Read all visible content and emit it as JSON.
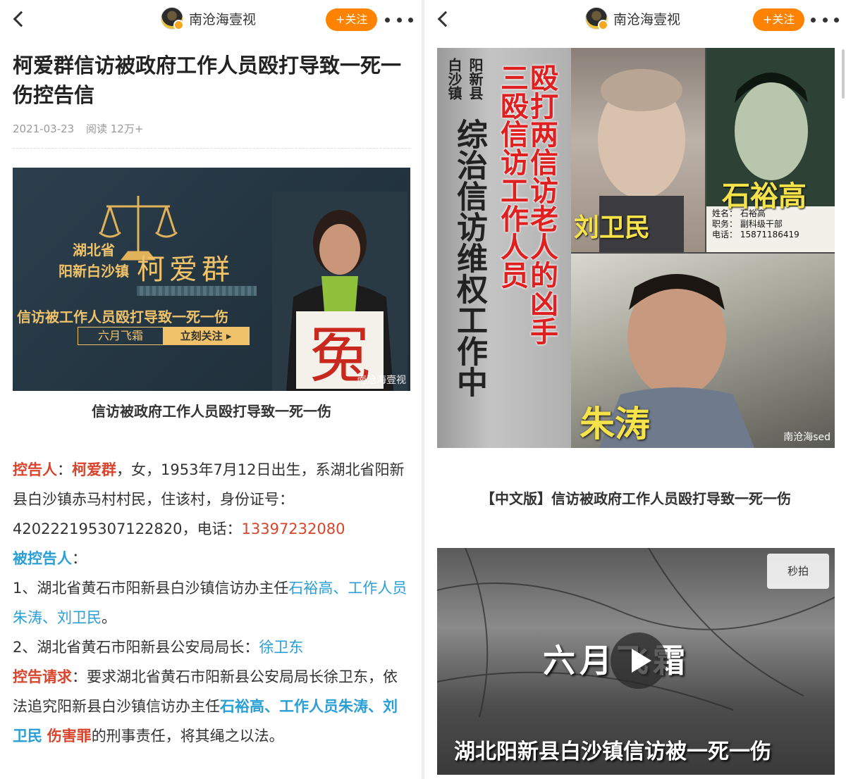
{
  "left": {
    "account_name": "南沧海壹视",
    "follow_label": "+关注",
    "title": "柯爱群信访被政府工作人员殴打导致一死一伤控告信",
    "date": "2021-03-23",
    "read_count": "阅读 12万+",
    "banner": {
      "region_1": "湖北省",
      "region_2": "阳新白沙镇",
      "name": "柯爱群",
      "headline": "信访被工作人员殴打导致一死一伤",
      "tag": "六月飞霜",
      "follow_cta": "立刻关注 ▸",
      "sign_char": "冤",
      "watermark": "南沧海壹视"
    },
    "caption": "信访被政府工作人员殴打导致一死一伤",
    "body": {
      "plaintiff_label": "控告人",
      "plaintiff_name": "柯爱群",
      "plaintiff_info": "，女，1953年7月12日出生，系湖北省阳新县白沙镇赤马村村民，住该村，身份证号：420222195307122820，电话：",
      "phone": "13397232080",
      "defendant_label": "被控告人",
      "item1_prefix": "1、湖北省黄石市阳新县白沙镇信访办主任",
      "item1_names": "石裕高、工作人员朱涛、刘卫民",
      "item2_prefix": "2、湖北省黄石市阳新县公安局局长：",
      "item2_name": "徐卫东",
      "request_label": "控告请求",
      "request_text": "：要求湖北省黄石市阳新县公安局局长徐卫东，依法追究阳新县白沙镇信访办主任",
      "request_names": "石裕高、工作人员朱涛、刘卫民",
      "crime": "伤害罪",
      "request_end": "的刑事责任，将其绳之以法。"
    }
  },
  "right": {
    "account_name": "南沧海壹视",
    "follow_label": "+关注",
    "poster": {
      "sign_a": "白沙镇",
      "sign_b": "阳新县",
      "sign_c": "综治信访维权工作中",
      "red_1": "三殴信访工作人员",
      "red_2": "殴打两信访老人的凶手",
      "name_liu": "刘卫民",
      "name_shi": "石裕高",
      "name_zhu": "朱涛",
      "id_line1": "姓名： 石裕高",
      "id_line2": "职务： 副科级干部",
      "id_line3": "电话： 15871186419",
      "watermark": "南沧海sed"
    },
    "caption": "【中文版】信访被政府工作人员殴打导致一死一伤",
    "video": {
      "title": "六月飞霜",
      "subtitle": "湖北阳新县白沙镇信访被一死一伤",
      "badge": "秒拍"
    }
  },
  "colors": {
    "follow": "#ff8200",
    "highlight_red": "#d9442c",
    "highlight_blue": "#2a9fd6",
    "banner_gold": "#f0c36b"
  }
}
